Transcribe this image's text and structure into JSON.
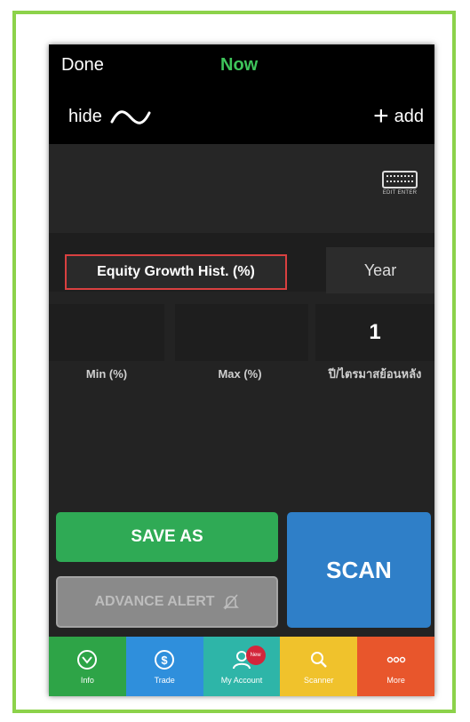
{
  "header": {
    "done_label": "Done",
    "now_label": "Now",
    "hide_label": "hide",
    "add_label": "add"
  },
  "keyboard": {
    "caption": "EDIT ENTER"
  },
  "filter": {
    "name": "Equity Growth Hist. (%)",
    "period_unit": "Year",
    "min_value": "",
    "max_value": "",
    "period_value": "1",
    "min_label": "Min (%)",
    "max_label": "Max (%)",
    "period_label": "ปี/ไตรมาสย้อนหลัง"
  },
  "actions": {
    "save_as": "SAVE AS",
    "advance_alert": "ADVANCE ALERT",
    "scan": "SCAN"
  },
  "tabs": [
    {
      "label": "Info",
      "icon": "info-icon",
      "color": "#2ea447"
    },
    {
      "label": "Trade",
      "icon": "dollar-icon",
      "color": "#2f8fdc"
    },
    {
      "label": "My Account",
      "icon": "user-icon",
      "color": "#2eb5a8",
      "badge": "New"
    },
    {
      "label": "Scanner",
      "icon": "search-icon",
      "color": "#f0c22c"
    },
    {
      "label": "More",
      "icon": "more-icon",
      "color": "#e8562c"
    }
  ],
  "colors": {
    "frame_border": "#8cd24a",
    "now_green": "#3ec45a",
    "highlight_red": "#d94040",
    "save_green": "#2faa55",
    "scan_blue": "#2f7fc8"
  }
}
